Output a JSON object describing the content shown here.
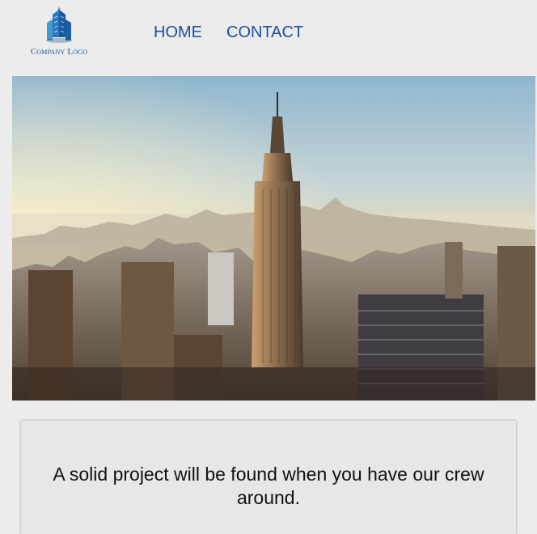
{
  "header": {
    "logo_text": "Company Logo",
    "nav": [
      {
        "label": "HOME"
      },
      {
        "label": "CONTACT"
      }
    ]
  },
  "hero": {
    "image": "city-skyline-photo"
  },
  "card": {
    "tagline": "A solid project will be found when you have our crew around."
  },
  "colors": {
    "nav_link": "#1c4fa0",
    "logo": "#1f5b8f",
    "background": "#ececec"
  }
}
